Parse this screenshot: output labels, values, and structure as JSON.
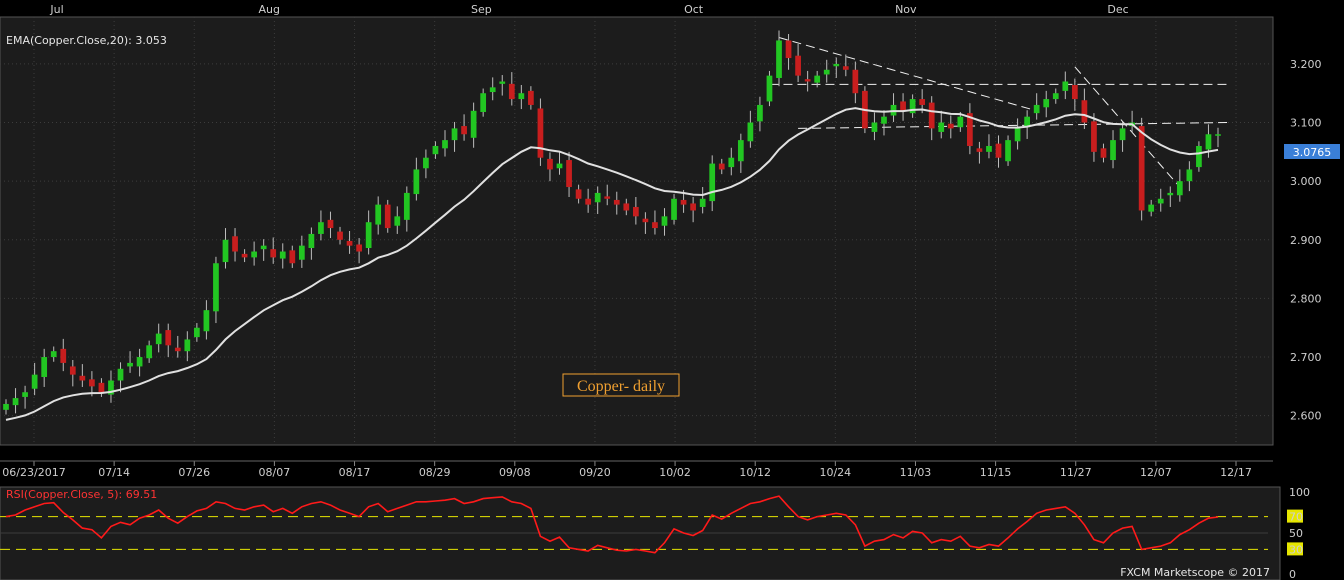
{
  "chart_data": {
    "type": "candlestick",
    "price_panel": {
      "indicator_label": "EMA(Copper.Close,20): 3.053",
      "annotation": "Copper- daily",
      "current_price": "3.0765",
      "ylim": [
        2.55,
        3.28
      ],
      "y_ticks": [
        "3.200",
        "3.100",
        "3.000",
        "2.900",
        "2.800",
        "2.700",
        "2.600"
      ],
      "x_ticks": [
        "06/23/2017",
        "07/14",
        "07/26",
        "08/07",
        "08/17",
        "08/29",
        "09/08",
        "09/20",
        "10/02",
        "10/12",
        "10/24",
        "11/03",
        "11/15",
        "11/27",
        "12/07",
        "12/17"
      ],
      "month_labels": [
        "Jul",
        "Aug",
        "Sep",
        "Oct",
        "Nov",
        "Dec"
      ],
      "closes": [
        2.62,
        2.63,
        2.64,
        2.67,
        2.7,
        2.71,
        2.69,
        2.67,
        2.66,
        2.65,
        2.64,
        2.66,
        2.68,
        2.69,
        2.7,
        2.72,
        2.74,
        2.72,
        2.71,
        2.73,
        2.75,
        2.78,
        2.86,
        2.9,
        2.88,
        2.87,
        2.88,
        2.89,
        2.87,
        2.88,
        2.86,
        2.89,
        2.91,
        2.93,
        2.92,
        2.9,
        2.89,
        2.88,
        2.93,
        2.96,
        2.92,
        2.94,
        2.98,
        3.02,
        3.04,
        3.06,
        3.07,
        3.09,
        3.08,
        3.12,
        3.15,
        3.16,
        3.17,
        3.14,
        3.15,
        3.13,
        3.04,
        3.02,
        3.03,
        2.99,
        2.97,
        2.96,
        2.98,
        2.97,
        2.96,
        2.95,
        2.94,
        2.93,
        2.92,
        2.94,
        2.97,
        2.96,
        2.95,
        2.97,
        3.03,
        3.02,
        3.04,
        3.07,
        3.1,
        3.13,
        3.18,
        3.24,
        3.21,
        3.18,
        3.17,
        3.18,
        3.19,
        3.2,
        3.19,
        3.15,
        3.09,
        3.1,
        3.11,
        3.13,
        3.12,
        3.14,
        3.13,
        3.09,
        3.1,
        3.09,
        3.11,
        3.06,
        3.05,
        3.06,
        3.04,
        3.07,
        3.09,
        3.11,
        3.13,
        3.14,
        3.15,
        3.17,
        3.14,
        3.1,
        3.05,
        3.04,
        3.07,
        3.09,
        3.1,
        2.95,
        2.96,
        2.97,
        2.98,
        3.0,
        3.02,
        3.06,
        3.08,
        3.08
      ]
    },
    "rsi_panel": {
      "indicator_label": "RSI(Copper.Close, 5): 69.51",
      "ylim": [
        0,
        100
      ],
      "y_ticks": [
        "100",
        "70",
        "50",
        "30",
        "0"
      ],
      "levels": [
        70,
        30
      ],
      "values": [
        70,
        72,
        78,
        82,
        86,
        87,
        75,
        66,
        56,
        54,
        44,
        58,
        63,
        60,
        68,
        72,
        78,
        68,
        62,
        70,
        77,
        80,
        88,
        86,
        80,
        78,
        82,
        84,
        76,
        80,
        74,
        82,
        86,
        88,
        84,
        78,
        74,
        70,
        82,
        86,
        76,
        80,
        84,
        88,
        88,
        89,
        90,
        92,
        86,
        88,
        92,
        93,
        94,
        88,
        86,
        80,
        46,
        40,
        45,
        32,
        30,
        28,
        35,
        32,
        29,
        28,
        30,
        28,
        26,
        38,
        55,
        50,
        47,
        53,
        72,
        67,
        74,
        80,
        86,
        88,
        92,
        95,
        82,
        70,
        66,
        70,
        72,
        74,
        72,
        60,
        34,
        40,
        42,
        48,
        44,
        52,
        50,
        38,
        42,
        40,
        46,
        34,
        32,
        36,
        34,
        44,
        55,
        64,
        74,
        78,
        80,
        82,
        74,
        60,
        42,
        38,
        50,
        56,
        58,
        30,
        32,
        34,
        38,
        48,
        54,
        62,
        68,
        69.51
      ]
    }
  },
  "footer": {
    "copyright": "FXCM Marketscope © 2017"
  },
  "colors": {
    "up": "#22c622",
    "down": "#c81e1e",
    "ema": "#e0e0e0",
    "rsi": "#ff1a1a",
    "level_line": "#e6e600",
    "annotation_text": "#f0a030",
    "annotation_border": "#f0a030",
    "price_tag": "#3a7fd8",
    "month_marker": "#c88a1e"
  }
}
